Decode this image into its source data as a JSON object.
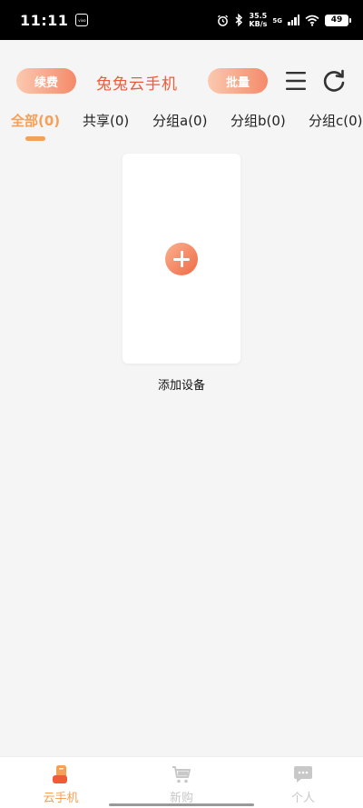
{
  "status_bar": {
    "time": "11:11",
    "net_speed_value": "35.5",
    "net_speed_unit": "KB/s",
    "network_tag": "5G",
    "battery": "49",
    "icons": [
      "alarm-icon",
      "bluetooth-icon",
      "signal-icon",
      "wifi-icon",
      "battery-icon"
    ]
  },
  "header": {
    "renew_label": "续费",
    "title": "兔兔云手机",
    "batch_label": "批量",
    "accent_color": "#ef5b3a"
  },
  "tabs": [
    {
      "label": "全部(0)",
      "active": true
    },
    {
      "label": "共享(0)",
      "active": false
    },
    {
      "label": "分组a(0)",
      "active": false
    },
    {
      "label": "分组b(0)",
      "active": false
    },
    {
      "label": "分组c(0)",
      "active": false
    }
  ],
  "tab_active_color": "#f5a057",
  "main": {
    "add_device_label": "添加设备"
  },
  "bottom_nav": [
    {
      "label": "云手机",
      "icon": "cloud-phone-icon",
      "active": true
    },
    {
      "label": "新购",
      "icon": "cart-icon",
      "active": false
    },
    {
      "label": "个人",
      "icon": "chat-bubble-icon",
      "active": false
    }
  ]
}
